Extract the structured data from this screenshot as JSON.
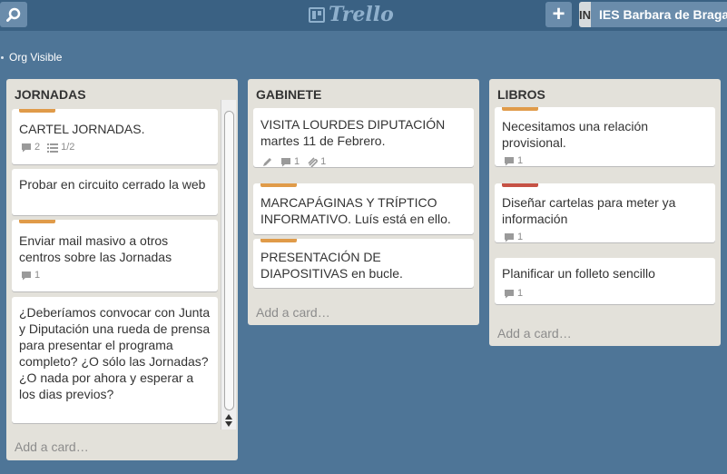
{
  "header": {
    "logo_text": "Trello",
    "org_initials": "IN",
    "org_name": "IES Barbara de Braganza"
  },
  "board": {
    "visibility": "Org Visible"
  },
  "colors": {
    "background": "#4e7597",
    "header": "#3a6183",
    "label_orange": "#e09b49",
    "label_red": "#c65245"
  },
  "lists": [
    {
      "title": "JORNADAS",
      "add_card": "Add a card…",
      "cards": [
        {
          "text": "CARTEL JORNADAS.",
          "label": "orange",
          "comments": "2",
          "checklist": "1/2"
        },
        {
          "text": "Probar en circuito cerrado la web"
        },
        {
          "text": "Enviar mail masivo a otros centros sobre las Jornadas",
          "label": "orange",
          "comments": "1"
        },
        {
          "text": "¿Deberíamos convocar con Junta y Diputación una rueda de prensa para presentar el programa completo? ¿O sólo las Jornadas? ¿O nada por ahora y esperar a los dias previos?"
        }
      ]
    },
    {
      "title": "GABINETE",
      "add_card": "Add a card…",
      "cards": [
        {
          "text": "VISITA LOURDES DIPUTACIÓN martes 11 de Febrero.",
          "comments": "1",
          "attachments": "1"
        },
        {
          "text": "MARCAPÁGINAS Y TRÍPTICO INFORMATIVO. Luís está en ello.",
          "label": "orange"
        },
        {
          "text": "PRESENTACIÓN DE DIAPOSITIVAS en bucle.",
          "label": "orange"
        }
      ]
    },
    {
      "title": "LIBROS",
      "add_card": "Add a card…",
      "cards": [
        {
          "text": "Necesitamos una relación provisional.",
          "label": "orange",
          "comments": "1"
        },
        {
          "text": "Diseñar cartelas para meter ya información",
          "label": "red",
          "comments": "1"
        },
        {
          "text": "Planificar un folleto sencillo",
          "comments": "1"
        }
      ]
    }
  ]
}
